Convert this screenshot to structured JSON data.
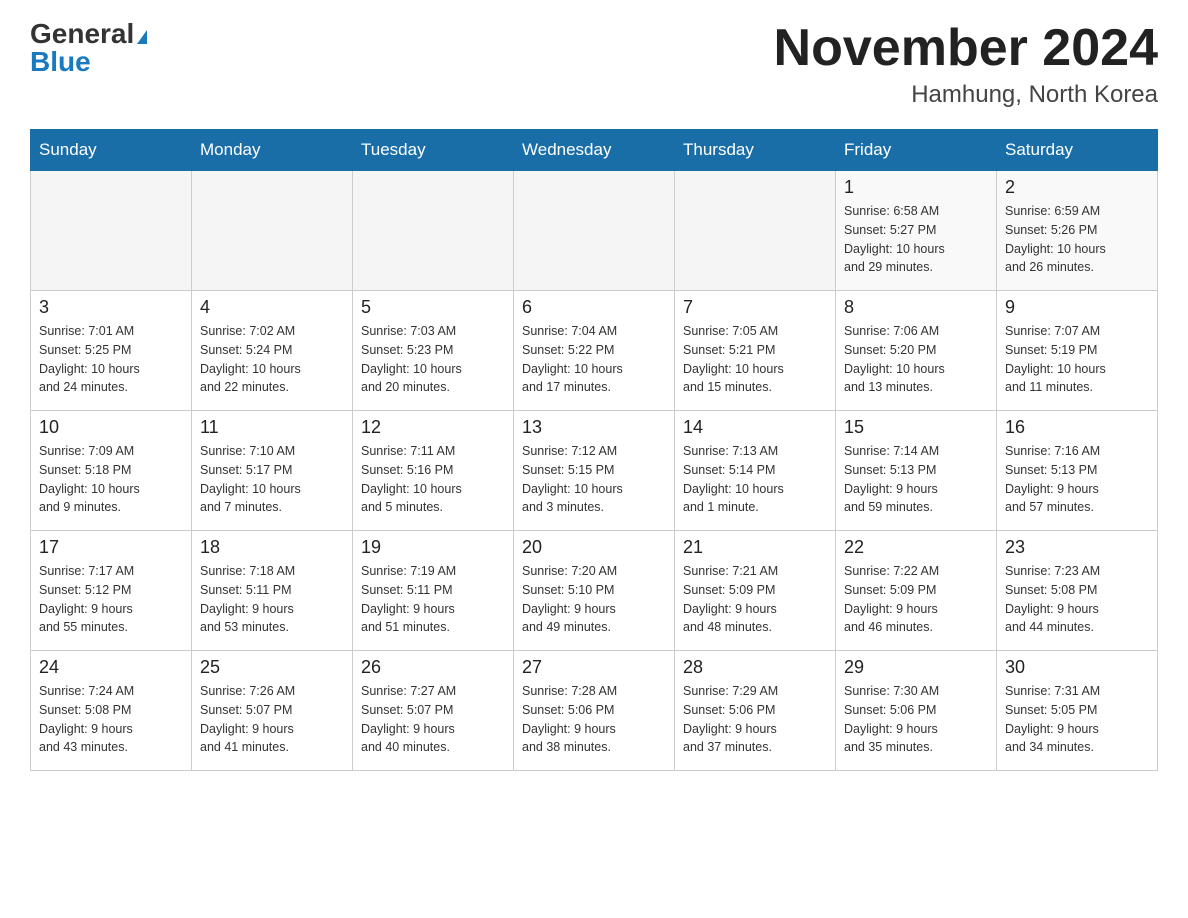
{
  "header": {
    "logo_general": "General",
    "logo_blue": "Blue",
    "main_title": "November 2024",
    "subtitle": "Hamhung, North Korea"
  },
  "weekdays": [
    "Sunday",
    "Monday",
    "Tuesday",
    "Wednesday",
    "Thursday",
    "Friday",
    "Saturday"
  ],
  "weeks": [
    [
      {
        "day": "",
        "info": ""
      },
      {
        "day": "",
        "info": ""
      },
      {
        "day": "",
        "info": ""
      },
      {
        "day": "",
        "info": ""
      },
      {
        "day": "",
        "info": ""
      },
      {
        "day": "1",
        "info": "Sunrise: 6:58 AM\nSunset: 5:27 PM\nDaylight: 10 hours\nand 29 minutes."
      },
      {
        "day": "2",
        "info": "Sunrise: 6:59 AM\nSunset: 5:26 PM\nDaylight: 10 hours\nand 26 minutes."
      }
    ],
    [
      {
        "day": "3",
        "info": "Sunrise: 7:01 AM\nSunset: 5:25 PM\nDaylight: 10 hours\nand 24 minutes."
      },
      {
        "day": "4",
        "info": "Sunrise: 7:02 AM\nSunset: 5:24 PM\nDaylight: 10 hours\nand 22 minutes."
      },
      {
        "day": "5",
        "info": "Sunrise: 7:03 AM\nSunset: 5:23 PM\nDaylight: 10 hours\nand 20 minutes."
      },
      {
        "day": "6",
        "info": "Sunrise: 7:04 AM\nSunset: 5:22 PM\nDaylight: 10 hours\nand 17 minutes."
      },
      {
        "day": "7",
        "info": "Sunrise: 7:05 AM\nSunset: 5:21 PM\nDaylight: 10 hours\nand 15 minutes."
      },
      {
        "day": "8",
        "info": "Sunrise: 7:06 AM\nSunset: 5:20 PM\nDaylight: 10 hours\nand 13 minutes."
      },
      {
        "day": "9",
        "info": "Sunrise: 7:07 AM\nSunset: 5:19 PM\nDaylight: 10 hours\nand 11 minutes."
      }
    ],
    [
      {
        "day": "10",
        "info": "Sunrise: 7:09 AM\nSunset: 5:18 PM\nDaylight: 10 hours\nand 9 minutes."
      },
      {
        "day": "11",
        "info": "Sunrise: 7:10 AM\nSunset: 5:17 PM\nDaylight: 10 hours\nand 7 minutes."
      },
      {
        "day": "12",
        "info": "Sunrise: 7:11 AM\nSunset: 5:16 PM\nDaylight: 10 hours\nand 5 minutes."
      },
      {
        "day": "13",
        "info": "Sunrise: 7:12 AM\nSunset: 5:15 PM\nDaylight: 10 hours\nand 3 minutes."
      },
      {
        "day": "14",
        "info": "Sunrise: 7:13 AM\nSunset: 5:14 PM\nDaylight: 10 hours\nand 1 minute."
      },
      {
        "day": "15",
        "info": "Sunrise: 7:14 AM\nSunset: 5:13 PM\nDaylight: 9 hours\nand 59 minutes."
      },
      {
        "day": "16",
        "info": "Sunrise: 7:16 AM\nSunset: 5:13 PM\nDaylight: 9 hours\nand 57 minutes."
      }
    ],
    [
      {
        "day": "17",
        "info": "Sunrise: 7:17 AM\nSunset: 5:12 PM\nDaylight: 9 hours\nand 55 minutes."
      },
      {
        "day": "18",
        "info": "Sunrise: 7:18 AM\nSunset: 5:11 PM\nDaylight: 9 hours\nand 53 minutes."
      },
      {
        "day": "19",
        "info": "Sunrise: 7:19 AM\nSunset: 5:11 PM\nDaylight: 9 hours\nand 51 minutes."
      },
      {
        "day": "20",
        "info": "Sunrise: 7:20 AM\nSunset: 5:10 PM\nDaylight: 9 hours\nand 49 minutes."
      },
      {
        "day": "21",
        "info": "Sunrise: 7:21 AM\nSunset: 5:09 PM\nDaylight: 9 hours\nand 48 minutes."
      },
      {
        "day": "22",
        "info": "Sunrise: 7:22 AM\nSunset: 5:09 PM\nDaylight: 9 hours\nand 46 minutes."
      },
      {
        "day": "23",
        "info": "Sunrise: 7:23 AM\nSunset: 5:08 PM\nDaylight: 9 hours\nand 44 minutes."
      }
    ],
    [
      {
        "day": "24",
        "info": "Sunrise: 7:24 AM\nSunset: 5:08 PM\nDaylight: 9 hours\nand 43 minutes."
      },
      {
        "day": "25",
        "info": "Sunrise: 7:26 AM\nSunset: 5:07 PM\nDaylight: 9 hours\nand 41 minutes."
      },
      {
        "day": "26",
        "info": "Sunrise: 7:27 AM\nSunset: 5:07 PM\nDaylight: 9 hours\nand 40 minutes."
      },
      {
        "day": "27",
        "info": "Sunrise: 7:28 AM\nSunset: 5:06 PM\nDaylight: 9 hours\nand 38 minutes."
      },
      {
        "day": "28",
        "info": "Sunrise: 7:29 AM\nSunset: 5:06 PM\nDaylight: 9 hours\nand 37 minutes."
      },
      {
        "day": "29",
        "info": "Sunrise: 7:30 AM\nSunset: 5:06 PM\nDaylight: 9 hours\nand 35 minutes."
      },
      {
        "day": "30",
        "info": "Sunrise: 7:31 AM\nSunset: 5:05 PM\nDaylight: 9 hours\nand 34 minutes."
      }
    ]
  ]
}
